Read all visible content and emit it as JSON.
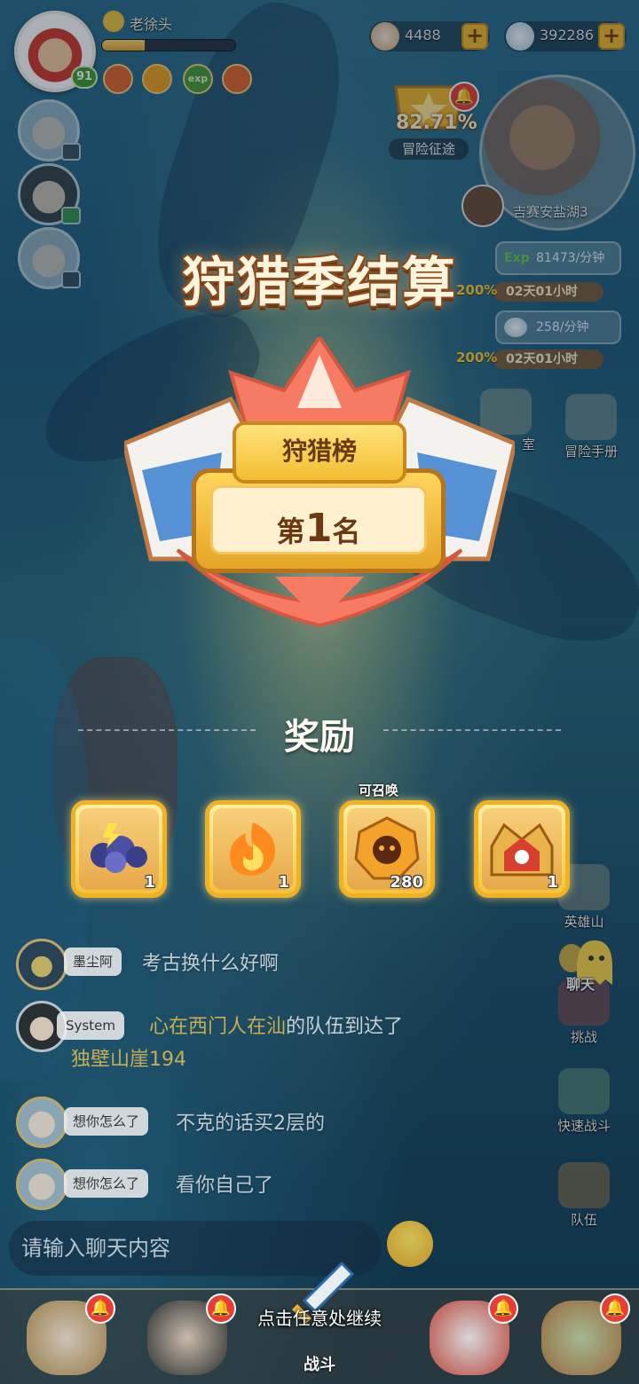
{
  "player": {
    "name": "老徐头",
    "level": "91",
    "exp_fraction": 0.32
  },
  "buffs": [
    "exp",
    "buff",
    "buff",
    "buff",
    "buff"
  ],
  "currency": [
    {
      "name": "shell-coin-icon",
      "value": "4488"
    },
    {
      "name": "gem-icon",
      "value": "392286"
    }
  ],
  "adventure": {
    "percent": "82.71%",
    "label": "冒险征途"
  },
  "map": {
    "location": "吉赛安盐湖3"
  },
  "boosts": [
    {
      "tag": "Exp",
      "rate": "81473/分钟",
      "multiplier": "200%",
      "timer": "02天01小时"
    },
    {
      "tag": "",
      "rate": "258/分钟",
      "multiplier": "200%",
      "timer": "02天01小时"
    }
  ],
  "right_buttons": {
    "hidden_left": "室",
    "handbook": "冒险手册",
    "hero_mountain": "英雄山",
    "chat": "聊天",
    "challenge": "挑战",
    "quick_battle": "快速战斗",
    "team": "队伍"
  },
  "overlay": {
    "title": "狩猎季结算",
    "ranking_board": "狩猎榜",
    "rank_prefix": "第",
    "rank_number": "1",
    "rank_suffix": "名",
    "rewards_title": "奖励",
    "summon_tag": "可召唤",
    "rewards": [
      {
        "name": "storm-cloud-icon",
        "count": "1"
      },
      {
        "name": "flame-icon",
        "count": "1"
      },
      {
        "name": "summon-gem-icon",
        "count": "280"
      },
      {
        "name": "crown-chest-icon",
        "count": "1"
      }
    ],
    "continue_hint": "点击任意处继续"
  },
  "chat": {
    "messages": [
      {
        "user": "墨尘阿",
        "text": "考古换什么好啊"
      },
      {
        "user": "System",
        "prefix": "心在西门人在",
        "w1": "汕",
        "mid": "的队伍",
        "w2": "到达了",
        "place": "独壁山崖194"
      },
      {
        "user": "想你怎么了",
        "text": "不克的话买2层的"
      },
      {
        "user": "想你怎么了",
        "text": "看你自己了"
      }
    ],
    "input_placeholder": "请输入聊天内容"
  },
  "bottom_nav": {
    "battle": "战斗"
  },
  "colors": {
    "gold": "#f2b025",
    "accent_red": "#e83d36",
    "title_text": "#fff4dc"
  }
}
